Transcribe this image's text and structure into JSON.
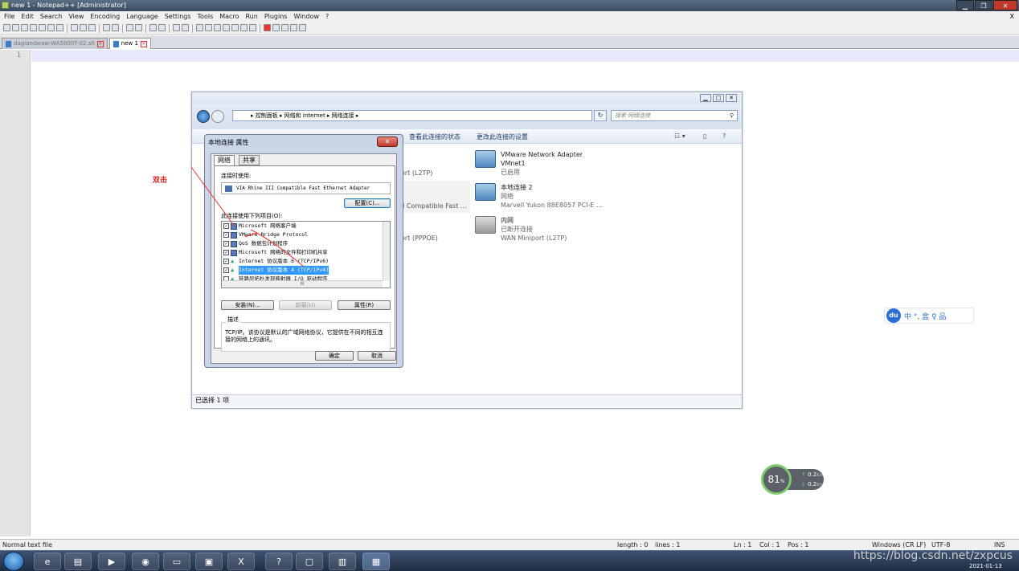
{
  "window": {
    "title": "new 1 - Notepad++ [Administrator]"
  },
  "menu": [
    "File",
    "Edit",
    "Search",
    "View",
    "Encoding",
    "Language",
    "Settings",
    "Tools",
    "Macro",
    "Run",
    "Plugins",
    "Window",
    "?"
  ],
  "tabs": [
    {
      "label": "dagiandwaw-WA5800T-02.sh"
    },
    {
      "label": "new 1"
    }
  ],
  "editor": {
    "line_number": "1"
  },
  "status": {
    "filetype": "Normal text file",
    "length": "length : 0",
    "lines": "lines : 1",
    "ln": "Ln : 1",
    "col": "Col : 1",
    "pos": "Pos : 1",
    "eol": "Windows (CR LF)",
    "encoding": "UTF-8",
    "mode": "INS"
  },
  "explorer": {
    "breadcrumb": "▸ 控制面板 ▸ 网络和 Internet ▸ 网络连接 ▸",
    "search_placeholder": "搜索 网络连接",
    "cmd_view_status": "查看此连接的状态",
    "cmd_change_settings": "更改此连接的设置",
    "status_text": "已选择 1 项",
    "partial_left": [
      "ort (L2TP)",
      "I Compatible Fast ...",
      "ort (PPPOE)"
    ],
    "items": [
      {
        "name": "VMware Network Adapter",
        "line2": "VMnet1",
        "line3": "已启用"
      },
      {
        "name": "本地连接 2",
        "line2": "网络",
        "line3": "Marvell Yukon 88E8057 PCI-E ..."
      },
      {
        "name": "内网",
        "line2": "已断开连接",
        "line3": "WAN Miniport (L2TP)"
      }
    ]
  },
  "dialog": {
    "title": "本地连接 属性",
    "tab_network": "网络",
    "tab_share": "共享",
    "connect_using_label": "连接时使用:",
    "adapter": "VIA Rhine III Compatible Fast Ethernet Adapter",
    "configure_btn": "配置(C)...",
    "items_label": "此连接使用下列项目(O):",
    "items": [
      {
        "label": "Microsoft 网络客户端",
        "checked": true
      },
      {
        "label": "VMware Bridge Protocol",
        "checked": true
      },
      {
        "label": "QoS 数据包计划程序",
        "checked": true
      },
      {
        "label": "Microsoft 网络的文件和打印机共享",
        "checked": true
      },
      {
        "label": "Internet 协议版本 6 (TCP/IPv6)",
        "checked": true
      },
      {
        "label": "Internet 协议版本 4 (TCP/IPv4)",
        "checked": true,
        "selected": true
      },
      {
        "label": "链路层拓扑发现映射器 I/O 驱动程序",
        "checked": false
      }
    ],
    "hscroll_text": "III",
    "install_btn": "安装(N)...",
    "uninstall_btn": "卸载(U)",
    "properties_btn": "属性(R)",
    "desc_label": "描述",
    "desc_text": "TCP/IP。该协议是默认的广域网络协议，它提供在不同的相互连接的网络上的通讯。",
    "ok_btn": "确定",
    "cancel_btn": "取消"
  },
  "annotation": "双击",
  "baidu": {
    "logo": "du",
    "chars": "中 °, 盒 ♀ 品"
  },
  "gauge": {
    "percent": "81",
    "unit": "%",
    "up": "0.2",
    "down": "0.2",
    "rate_unit": "K/s"
  },
  "taskbar": {
    "icons": [
      "ie-icon",
      "explorer-icon",
      "media-player-icon",
      "chrome-icon",
      "monitor-icon",
      "outlook-icon",
      "excel-icon",
      "help-icon",
      "terminal-icon",
      "chart-icon",
      "network-icon"
    ]
  },
  "watermark": "https://blog.csdn.net/zxpcus",
  "clock": {
    "date": "2021-01-13"
  }
}
